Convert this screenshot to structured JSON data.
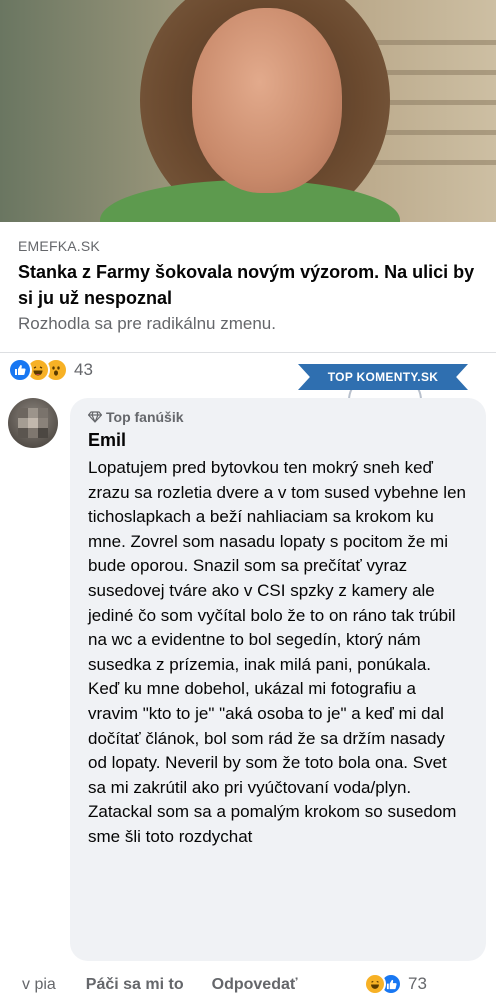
{
  "article": {
    "source": "EMEFKA.SK",
    "headline": "Stanka z Farmy šokovala novým výzorom. Na ulici by si ju už nespoznal",
    "subtitle": "Rozhodla sa pre radikálnu zmenu."
  },
  "post_reactions": {
    "icons": [
      "like-icon",
      "haha-icon",
      "wow-icon"
    ],
    "count": "43"
  },
  "badge": {
    "label": "TOP KOMENTY.SK"
  },
  "comment": {
    "fan_badge": "Top fanúšik",
    "author": "Emil",
    "paragraphs": [
      "Lopatujem pred bytovkou ten mokrý sneh keď zrazu sa rozletia dvere a v tom sused vybehne len tichoslapkach a beží nahliaciam sa krokom ku mne. Zovrel som nasadu lopaty s pocitom že mi bude oporou. Snazil som sa prečítať vyraz susedovej tváre ako v CSI spzky z kamery ale jediné čo som vyčítal bolo že to on ráno tak trúbil na wc a evidentne to bol segedín, ktorý nám susedka z prízemia, inak milá pani, ponúkala.",
      "Keď ku mne dobehol, ukázal mi fotografiu a vravim \"kto to je\" \"aká osoba to je\" a keď mi dal dočítať článok, bol som rád že sa držím nasady od lopaty. Neveril by som že toto bola ona. Svet sa mi zakrútil ako pri vyúčtovaní voda/plyn. Zatackal som sa a pomalým krokom so susedom sme šli toto rozdychat"
    ]
  },
  "comment_actions": {
    "time": "v pia",
    "like": "Páči sa mi to",
    "reply": "Odpovedať",
    "reaction_icons": [
      "haha-icon",
      "like-icon"
    ],
    "reaction_count": "73"
  },
  "colors": {
    "accent": "#1877f2",
    "secondary_text": "#65676b",
    "bubble_bg": "#f0f2f5",
    "badge_blue": "#2f6fb0"
  }
}
